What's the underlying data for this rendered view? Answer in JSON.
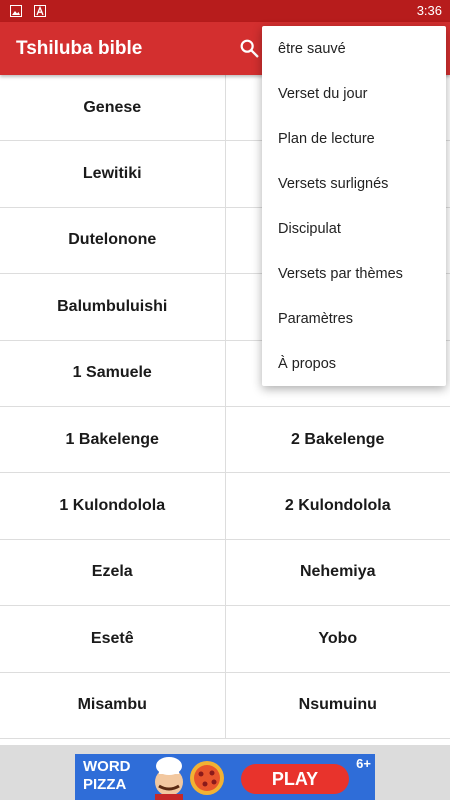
{
  "status_bar": {
    "time": "3:36",
    "icons": [
      "image-icon",
      "a-icon"
    ]
  },
  "app_bar": {
    "title": "Tshiluba bible",
    "search_icon": "search-icon"
  },
  "books": [
    [
      "Genese",
      ""
    ],
    [
      "Lewitiki",
      ""
    ],
    [
      "Dutelonone",
      ""
    ],
    [
      "Balumbuluishi",
      ""
    ],
    [
      "1 Samuele",
      ""
    ],
    [
      "1 Bakelenge",
      "2 Bakelenge"
    ],
    [
      "1 Kulondolola",
      "2 Kulondolola"
    ],
    [
      "Ezela",
      "Nehemiya"
    ],
    [
      "Esetê",
      "Yobo"
    ],
    [
      "Misambu",
      "Nsumuinu"
    ]
  ],
  "menu": {
    "items": [
      "être sauvé",
      "Verset du jour",
      "Plan de lecture",
      "Versets surlignés",
      "Discipulat",
      "Versets par thèmes",
      "Paramètres",
      "À propos"
    ]
  },
  "ad": {
    "title": "WORD PIZZA",
    "button": "PLAY",
    "age": "6+",
    "colors": {
      "background": "#2f6dd8",
      "button": "#e8332c"
    }
  },
  "colors": {
    "status_bar": "#b71c1c",
    "app_bar": "#d32f2f"
  }
}
